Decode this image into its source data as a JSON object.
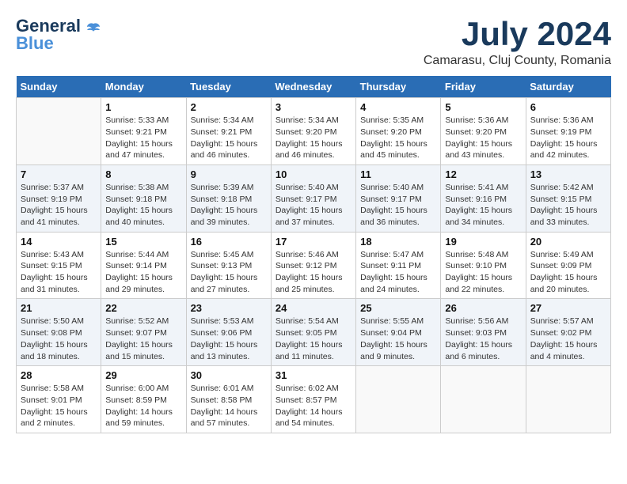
{
  "header": {
    "logo_general": "General",
    "logo_blue": "Blue",
    "month_title": "July 2024",
    "location": "Camarasu, Cluj County, Romania"
  },
  "days_of_week": [
    "Sunday",
    "Monday",
    "Tuesday",
    "Wednesday",
    "Thursday",
    "Friday",
    "Saturday"
  ],
  "weeks": [
    [
      {
        "day": "",
        "info": ""
      },
      {
        "day": "1",
        "info": "Sunrise: 5:33 AM\nSunset: 9:21 PM\nDaylight: 15 hours\nand 47 minutes."
      },
      {
        "day": "2",
        "info": "Sunrise: 5:34 AM\nSunset: 9:21 PM\nDaylight: 15 hours\nand 46 minutes."
      },
      {
        "day": "3",
        "info": "Sunrise: 5:34 AM\nSunset: 9:20 PM\nDaylight: 15 hours\nand 46 minutes."
      },
      {
        "day": "4",
        "info": "Sunrise: 5:35 AM\nSunset: 9:20 PM\nDaylight: 15 hours\nand 45 minutes."
      },
      {
        "day": "5",
        "info": "Sunrise: 5:36 AM\nSunset: 9:20 PM\nDaylight: 15 hours\nand 43 minutes."
      },
      {
        "day": "6",
        "info": "Sunrise: 5:36 AM\nSunset: 9:19 PM\nDaylight: 15 hours\nand 42 minutes."
      }
    ],
    [
      {
        "day": "7",
        "info": "Sunrise: 5:37 AM\nSunset: 9:19 PM\nDaylight: 15 hours\nand 41 minutes."
      },
      {
        "day": "8",
        "info": "Sunrise: 5:38 AM\nSunset: 9:18 PM\nDaylight: 15 hours\nand 40 minutes."
      },
      {
        "day": "9",
        "info": "Sunrise: 5:39 AM\nSunset: 9:18 PM\nDaylight: 15 hours\nand 39 minutes."
      },
      {
        "day": "10",
        "info": "Sunrise: 5:40 AM\nSunset: 9:17 PM\nDaylight: 15 hours\nand 37 minutes."
      },
      {
        "day": "11",
        "info": "Sunrise: 5:40 AM\nSunset: 9:17 PM\nDaylight: 15 hours\nand 36 minutes."
      },
      {
        "day": "12",
        "info": "Sunrise: 5:41 AM\nSunset: 9:16 PM\nDaylight: 15 hours\nand 34 minutes."
      },
      {
        "day": "13",
        "info": "Sunrise: 5:42 AM\nSunset: 9:15 PM\nDaylight: 15 hours\nand 33 minutes."
      }
    ],
    [
      {
        "day": "14",
        "info": "Sunrise: 5:43 AM\nSunset: 9:15 PM\nDaylight: 15 hours\nand 31 minutes."
      },
      {
        "day": "15",
        "info": "Sunrise: 5:44 AM\nSunset: 9:14 PM\nDaylight: 15 hours\nand 29 minutes."
      },
      {
        "day": "16",
        "info": "Sunrise: 5:45 AM\nSunset: 9:13 PM\nDaylight: 15 hours\nand 27 minutes."
      },
      {
        "day": "17",
        "info": "Sunrise: 5:46 AM\nSunset: 9:12 PM\nDaylight: 15 hours\nand 25 minutes."
      },
      {
        "day": "18",
        "info": "Sunrise: 5:47 AM\nSunset: 9:11 PM\nDaylight: 15 hours\nand 24 minutes."
      },
      {
        "day": "19",
        "info": "Sunrise: 5:48 AM\nSunset: 9:10 PM\nDaylight: 15 hours\nand 22 minutes."
      },
      {
        "day": "20",
        "info": "Sunrise: 5:49 AM\nSunset: 9:09 PM\nDaylight: 15 hours\nand 20 minutes."
      }
    ],
    [
      {
        "day": "21",
        "info": "Sunrise: 5:50 AM\nSunset: 9:08 PM\nDaylight: 15 hours\nand 18 minutes."
      },
      {
        "day": "22",
        "info": "Sunrise: 5:52 AM\nSunset: 9:07 PM\nDaylight: 15 hours\nand 15 minutes."
      },
      {
        "day": "23",
        "info": "Sunrise: 5:53 AM\nSunset: 9:06 PM\nDaylight: 15 hours\nand 13 minutes."
      },
      {
        "day": "24",
        "info": "Sunrise: 5:54 AM\nSunset: 9:05 PM\nDaylight: 15 hours\nand 11 minutes."
      },
      {
        "day": "25",
        "info": "Sunrise: 5:55 AM\nSunset: 9:04 PM\nDaylight: 15 hours\nand 9 minutes."
      },
      {
        "day": "26",
        "info": "Sunrise: 5:56 AM\nSunset: 9:03 PM\nDaylight: 15 hours\nand 6 minutes."
      },
      {
        "day": "27",
        "info": "Sunrise: 5:57 AM\nSunset: 9:02 PM\nDaylight: 15 hours\nand 4 minutes."
      }
    ],
    [
      {
        "day": "28",
        "info": "Sunrise: 5:58 AM\nSunset: 9:01 PM\nDaylight: 15 hours\nand 2 minutes."
      },
      {
        "day": "29",
        "info": "Sunrise: 6:00 AM\nSunset: 8:59 PM\nDaylight: 14 hours\nand 59 minutes."
      },
      {
        "day": "30",
        "info": "Sunrise: 6:01 AM\nSunset: 8:58 PM\nDaylight: 14 hours\nand 57 minutes."
      },
      {
        "day": "31",
        "info": "Sunrise: 6:02 AM\nSunset: 8:57 PM\nDaylight: 14 hours\nand 54 minutes."
      },
      {
        "day": "",
        "info": ""
      },
      {
        "day": "",
        "info": ""
      },
      {
        "day": "",
        "info": ""
      }
    ]
  ]
}
